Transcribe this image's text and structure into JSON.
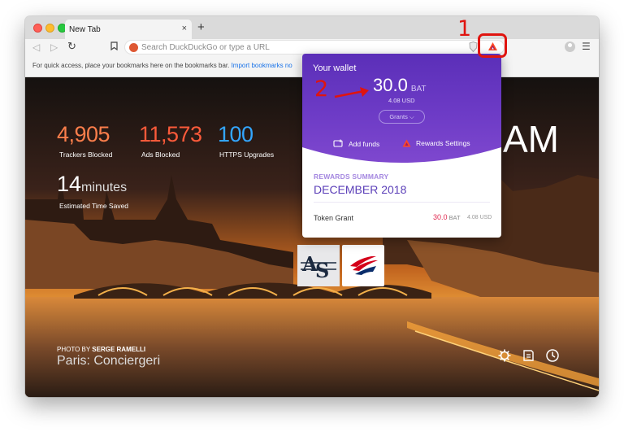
{
  "browser": {
    "tab_title": "New Tab",
    "tab_close": "×",
    "new_tab": "+",
    "omnibox_placeholder": "Search DuckDuckGo or type a URL",
    "bookmarks_hint": "For quick access, place your bookmarks here on the bookmarks bar.",
    "bookmarks_link": "Import bookmarks no"
  },
  "stats": {
    "trackers_blocked": "4,905",
    "trackers_label": "Trackers Blocked",
    "ads_blocked": "11,573",
    "ads_label": "Ads Blocked",
    "https_upgrades": "100",
    "https_label": "HTTPS Upgrades",
    "time_value": "14",
    "time_unit": "minutes",
    "time_label": "Estimated Time Saved"
  },
  "clock": "AM",
  "photo": {
    "credit_prefix": "PHOTO BY",
    "photographer": "SERGE RAMELLI",
    "title": "Paris: Conciergeri"
  },
  "tiles": [
    {
      "label": "AS"
    },
    {
      "label": "Bank of America"
    }
  ],
  "wallet": {
    "title": "Your wallet",
    "balance": "30.0",
    "unit": "BAT",
    "usd": "4.08 USD",
    "grants_label": "Grants",
    "add_funds": "Add funds",
    "rewards_settings": "Rewards Settings",
    "summary_label": "REWARDS SUMMARY",
    "summary_month": "DECEMBER 2018",
    "grant_label": "Token Grant",
    "grant_value": "30.0",
    "grant_unit": "BAT",
    "grant_usd": "4.08 USD"
  },
  "annotations": {
    "step1": "1",
    "step2": "2"
  },
  "colors": {
    "wallet_purple": "#6d3bc6",
    "annotation_red": "#e0140f",
    "trackers_orange": "#fb7e4b",
    "ads_orange": "#fb5a3a",
    "https_blue": "#33a6ff"
  }
}
